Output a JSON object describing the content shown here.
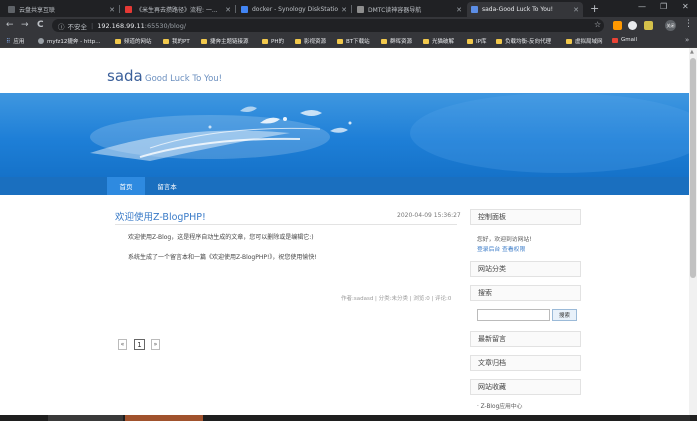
{
  "browser": {
    "tabs": [
      {
        "title": "云盘共享互联",
        "fav_color": "#5f6368"
      },
      {
        "title": "《米生再去攒路径》流程: 一...",
        "fav_color": "#e53935"
      },
      {
        "title": "docker - Synology DiskStation",
        "fav_color": "#4285f4"
      },
      {
        "title": "DMTC读神容器导航",
        "fav_color": "#8e8e8e"
      },
      {
        "title": "sada-Good Luck To You!",
        "fav_color": "#5c8ee6"
      }
    ],
    "new_tab": "+",
    "window": {
      "min": "—",
      "max": "❐",
      "close": "✕"
    },
    "nav": {
      "back": "←",
      "forward": "→",
      "reload": "C"
    },
    "address": {
      "info_icon": "ⓘ",
      "insecure": "不安全",
      "sep": "|",
      "host": "192.168.99.11",
      "path": ":65530/blog/"
    },
    "star": "☆",
    "extensions": [
      {
        "color": "#ff9800"
      },
      {
        "color": "#e8eaed"
      },
      {
        "color": "#d4c14a"
      }
    ],
    "profile": "关闭",
    "menu": "⋮",
    "bookmarks": [
      {
        "label": "应用",
        "icon": "apps"
      },
      {
        "label": "myfz12捷奔 - http...",
        "icon": "globe"
      },
      {
        "label": "频道的网站",
        "icon": "folder"
      },
      {
        "label": "我的PT",
        "icon": "folder"
      },
      {
        "label": "捷奔主题链接源",
        "icon": "folder"
      },
      {
        "label": "PH的",
        "icon": "folder"
      },
      {
        "label": "影视资源",
        "icon": "folder"
      },
      {
        "label": "BT下载站",
        "icon": "folder"
      },
      {
        "label": "群晖资源",
        "icon": "folder"
      },
      {
        "label": "光猫破解",
        "icon": "folder"
      },
      {
        "label": "IP库",
        "icon": "folder"
      },
      {
        "label": "负载均衡-反向代理",
        "icon": "folder"
      },
      {
        "label": "虚拟局域网",
        "icon": "folder"
      },
      {
        "label": "Gmail",
        "icon": "mail"
      }
    ],
    "bookmarks_more": "»"
  },
  "site": {
    "title": "sada",
    "subtitle": "Good Luck To You!",
    "nav": [
      {
        "label": "首页",
        "active": true
      },
      {
        "label": "留言本",
        "active": false
      }
    ]
  },
  "post": {
    "title": "欢迎使用Z-BlogPHP!",
    "date": "2020-04-09 15:36:27",
    "paragraphs": [
      "欢迎使用Z-Blog，这是程序自动生成的文章，您可以删除或是编辑它:)",
      "系统生成了一个留言本和一篇《欢迎使用Z-BlogPHP!》，祝您使用愉快!"
    ],
    "meta": "作者:sadasd | 分类:未分类 | 浏览:0 | 评论:0"
  },
  "pagination": {
    "prev": "«",
    "current": "1",
    "next": "»"
  },
  "sidebar": {
    "control_panel": {
      "title": "控制面板",
      "welcome": "您好，欢迎到访网站!",
      "login": "登录后台",
      "view_perms": "查看权限"
    },
    "categories_title": "网站分类",
    "search": {
      "title": "搜索",
      "button": "搜索"
    },
    "latest_comments_title": "最新留言",
    "archives_title": "文章归档",
    "favorites_title": "网站收藏",
    "favorite_link": "· Z-Blog应用中心"
  }
}
